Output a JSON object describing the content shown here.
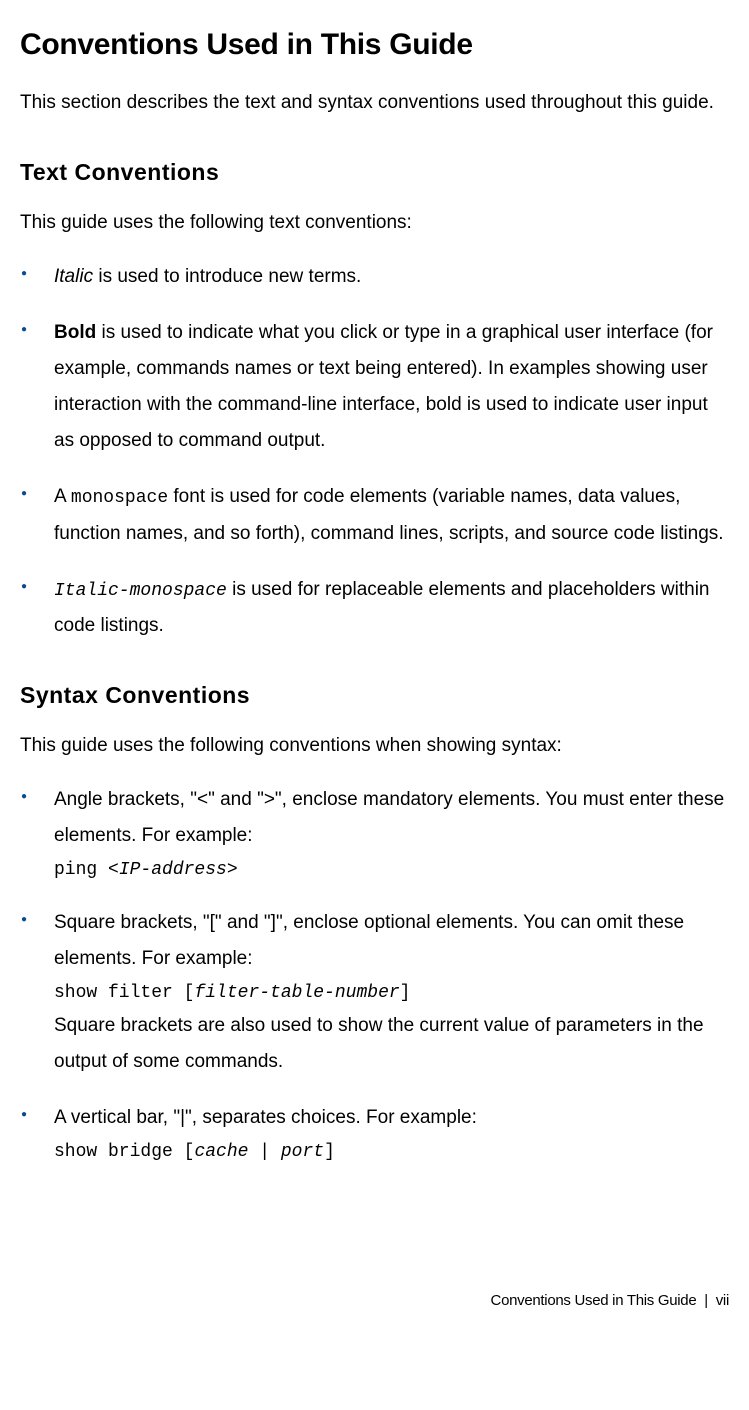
{
  "h1": "Conventions Used in This Guide",
  "intro": "This section describes the text and syntax conventions used throughout this guide.",
  "textConv": {
    "heading": "Text Conventions",
    "lead": "This guide uses the following text conventions:",
    "items": {
      "italic": {
        "term": "Italic",
        "rest": " is used to introduce new terms."
      },
      "bold": {
        "term": "Bold",
        "rest": " is used to indicate what you click or type in a graphical user interface (for example, commands names or text being entered). In examples showing user interaction with the command-line interface, bold is used to indicate user input as opposed to command output."
      },
      "mono": {
        "pre": "A ",
        "term": "monospace",
        "rest": " font is used for code elements (variable names, data values, function names, and so forth), command lines, scripts, and source code listings."
      },
      "italmono": {
        "term": "Italic-monospace",
        "rest": " is used for replaceable elements and placeholders within code listings."
      }
    }
  },
  "syntaxConv": {
    "heading": "Syntax Conventions",
    "lead": "This guide uses the following conventions when showing syntax:",
    "angle": {
      "text": "Angle brackets, \"<\" and \">\", enclose mandatory elements. You must enter these elements. For example:",
      "code_pre": "ping <",
      "code_var": "IP-address",
      "code_post": ">"
    },
    "square": {
      "text": "Square brackets, \"[\" and \"]\", enclose optional elements. You can omit these elements. For example:",
      "code_pre": "show filter [",
      "code_var": "filter-table-number",
      "code_post": "]",
      "after": "Square brackets are also used to show the current value of parameters in the output of some commands."
    },
    "bar": {
      "text": "A vertical bar, \"|\", separates choices. For example:",
      "code_pre": "show bridge [",
      "code_var1": "cache",
      "code_mid": " | ",
      "code_var2": "port",
      "code_post": "]"
    }
  },
  "footer": {
    "title": "Conventions Used in This Guide",
    "sep": "|",
    "page": "vii"
  }
}
